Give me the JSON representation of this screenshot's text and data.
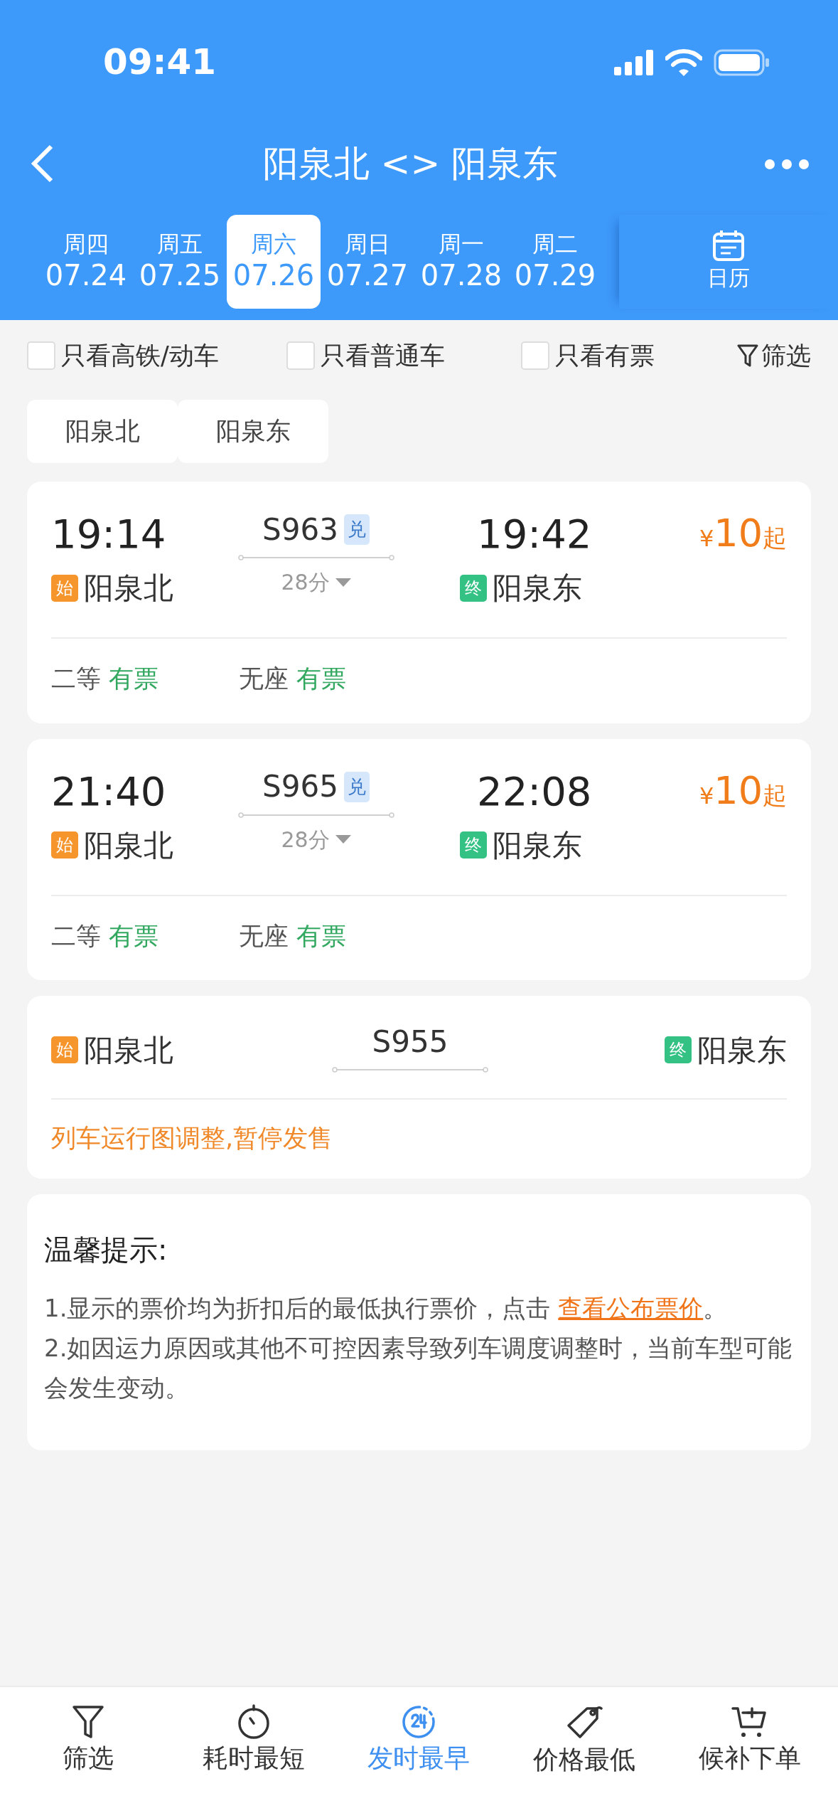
{
  "status_bar": {
    "time": "09:41"
  },
  "header": {
    "title": "阳泉北 <> 阳泉东"
  },
  "dates": [
    {
      "weekday": "周四",
      "date": "07.24",
      "selected": false
    },
    {
      "weekday": "周五",
      "date": "07.25",
      "selected": false
    },
    {
      "weekday": "周六",
      "date": "07.26",
      "selected": true
    },
    {
      "weekday": "周日",
      "date": "07.27",
      "selected": false
    },
    {
      "weekday": "周一",
      "date": "07.28",
      "selected": false
    },
    {
      "weekday": "周二",
      "date": "07.29",
      "selected": false
    }
  ],
  "calendar": {
    "label": "日历"
  },
  "filters": [
    {
      "label": "只看高铁/动车",
      "checked": false
    },
    {
      "label": "只看普通车",
      "checked": false
    },
    {
      "label": "只看有票",
      "checked": false
    }
  ],
  "filter_button": {
    "label": "筛选"
  },
  "station_chips": [
    {
      "label": "阳泉北"
    },
    {
      "label": "阳泉东"
    }
  ],
  "trains": [
    {
      "kind": "normal",
      "depart_time": "19:14",
      "train_no": "S963",
      "ticket_badge": "兑",
      "arrive_time": "19:42",
      "from_badge": "始",
      "from": "阳泉北",
      "duration": "28分",
      "to_badge": "终",
      "to": "阳泉东",
      "price": {
        "symbol": "¥",
        "amount": "10",
        "suffix": "起"
      },
      "seats": [
        {
          "class": "二等",
          "availability": "有票"
        },
        {
          "class": "无座",
          "availability": "有票"
        }
      ]
    },
    {
      "kind": "normal",
      "depart_time": "21:40",
      "train_no": "S965",
      "ticket_badge": "兑",
      "arrive_time": "22:08",
      "from_badge": "始",
      "from": "阳泉北",
      "duration": "28分",
      "to_badge": "终",
      "to": "阳泉东",
      "price": {
        "symbol": "¥",
        "amount": "10",
        "suffix": "起"
      },
      "seats": [
        {
          "class": "二等",
          "availability": "有票"
        },
        {
          "class": "无座",
          "availability": "有票"
        }
      ]
    },
    {
      "kind": "suspended",
      "from_badge": "始",
      "from": "阳泉北",
      "train_no": "S955",
      "to_badge": "终",
      "to": "阳泉东",
      "notice": "列车运行图调整,暂停发售"
    }
  ],
  "tips": {
    "title": "温馨提示:",
    "lines": [
      {
        "text": "1.显示的票价均为折扣后的最低执行票价，点击 ",
        "link": "查看公布票价",
        "tail": "。"
      },
      {
        "text": "2.如因运力原因或其他不可控因素导致列车调度调整时，当前车型可能会发生变动。"
      }
    ]
  },
  "bottom_nav": [
    {
      "label": "筛选",
      "selected": false
    },
    {
      "label": "耗时最短",
      "selected": false
    },
    {
      "label": "发时最早",
      "selected": true
    },
    {
      "label": "价格最低",
      "selected": false
    },
    {
      "label": "候补下单",
      "selected": false
    }
  ]
}
